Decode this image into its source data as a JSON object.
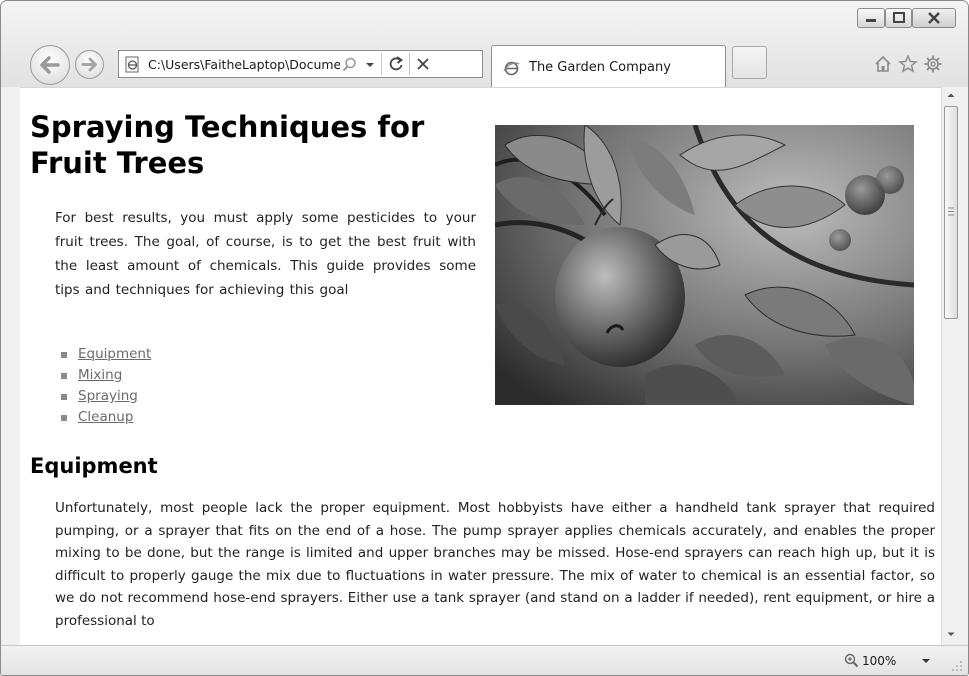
{
  "browser": {
    "address": "C:\\Users\\FaitheLaptop\\Documents\\M",
    "tab_title": "The Garden Company",
    "zoom": "100%"
  },
  "page": {
    "title": "Spraying Techniques for Fruit Trees",
    "intro": "For best results, you must apply some pesticides to your fruit trees. The goal, of course, is to get the best fruit with the least amount of chemicals. This guide provides some tips and techniques for achieving this goal",
    "toc": [
      {
        "label": "Equipment"
      },
      {
        "label": "Mixing"
      },
      {
        "label": "Spraying"
      },
      {
        "label": "Cleanup"
      }
    ],
    "section_title": "Equipment",
    "section_body": "Unfortunately, most people lack the proper equipment. Most hobbyists have either a handheld tank sprayer that required pumping, or a sprayer that fits on the end of a hose. The pump sprayer applies chemicals accurately, and enables the proper mixing to be done, but the range is limited and upper branches may be missed. Hose-end sprayers can reach high up, but it is difficult to properly gauge the mix due to fluctuations in water pressure. The mix of water to chemical is an essential factor, so we do not recommend hose-end sprayers. Either use a tank sprayer (and stand on a ladder if needed), rent equipment, or hire a professional to"
  },
  "icons": {
    "back": "back-arrow-icon",
    "forward": "forward-arrow-icon",
    "page": "page-icon",
    "search": "search-icon",
    "refresh": "refresh-icon",
    "stop": "close-icon",
    "home": "home-icon",
    "favorites": "star-icon",
    "tools": "gear-icon",
    "zoom": "zoom-icon"
  },
  "colors": {
    "link": "#6a6a6a",
    "text": "#222222",
    "chrome": "#e8e8e8"
  }
}
